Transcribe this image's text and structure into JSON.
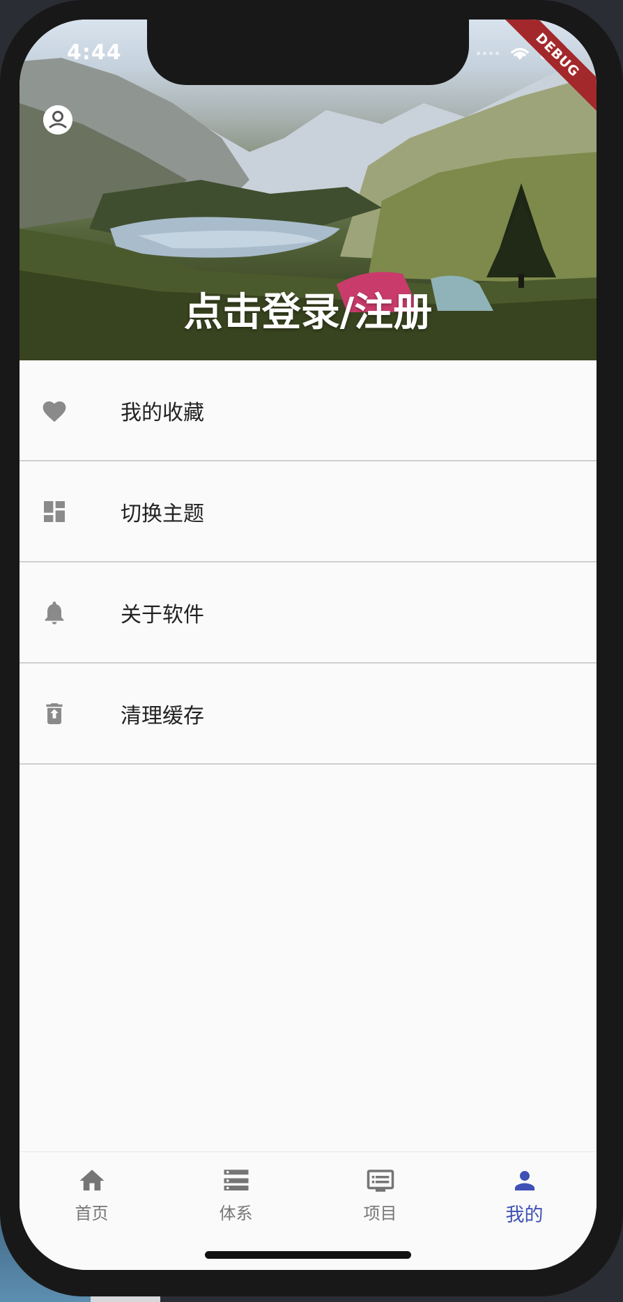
{
  "status_bar": {
    "time": "4:44",
    "debug_banner": "DEBUG"
  },
  "header": {
    "login_text": "点击登录/注册"
  },
  "menu": {
    "items": [
      {
        "label": "我的收藏",
        "icon": "heart-icon"
      },
      {
        "label": "切换主题",
        "icon": "dashboard-icon"
      },
      {
        "label": "关于软件",
        "icon": "bell-icon"
      },
      {
        "label": "清理缓存",
        "icon": "trash-icon"
      }
    ]
  },
  "bottom_nav": {
    "items": [
      {
        "label": "首页",
        "icon": "home-icon",
        "active": false
      },
      {
        "label": "体系",
        "icon": "list-icon",
        "active": false
      },
      {
        "label": "项目",
        "icon": "monitor-icon",
        "active": false
      },
      {
        "label": "我的",
        "icon": "person-icon",
        "active": true
      }
    ]
  },
  "colors": {
    "accent": "#3f51b5",
    "icon_gray": "#8a8a8a",
    "debug_red": "#a3282b"
  }
}
